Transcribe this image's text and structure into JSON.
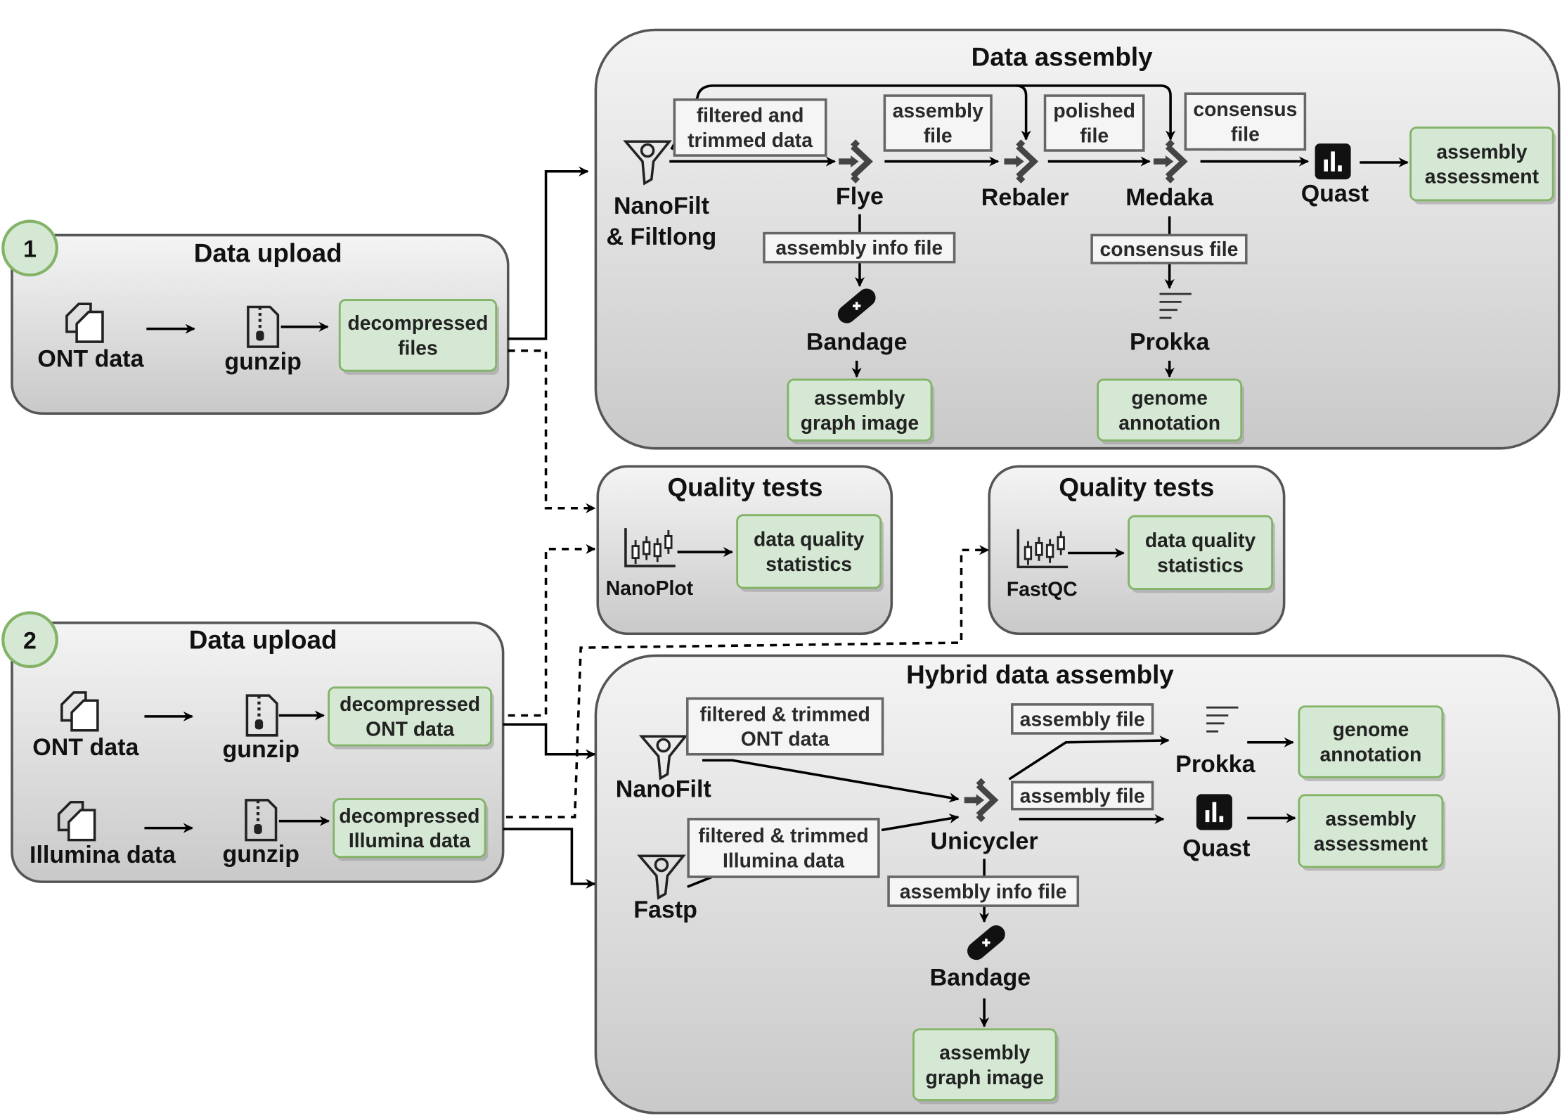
{
  "upload1": {
    "title": "Data upload",
    "badge": "1",
    "input": "ONT data",
    "tool": "gunzip",
    "output": [
      "decompressed",
      "files"
    ]
  },
  "assembly": {
    "title": "Data assembly",
    "filter_tool": [
      "NanoFilt",
      "& Filtlong"
    ],
    "filtered_label": [
      "filtered and",
      "trimmed data"
    ],
    "flye": "Flye",
    "assembly_file_label": [
      "assembly",
      "file"
    ],
    "rebaler": "Rebaler",
    "polished_label": [
      "polished",
      "file"
    ],
    "medaka": "Medaka",
    "consensus_label": [
      "consensus",
      "file"
    ],
    "quast": "Quast",
    "assessment": [
      "assembly",
      "assessment"
    ],
    "assembly_info_label": "assembly info file",
    "bandage": "Bandage",
    "graph_image": [
      "assembly",
      "graph image"
    ],
    "consensus_file_label": "consensus file",
    "prokka": "Prokka",
    "genome_annotation": [
      "genome",
      "annotation"
    ]
  },
  "quality1": {
    "title": "Quality tests",
    "tool": "NanoPlot",
    "output": [
      "data quality",
      "statistics"
    ]
  },
  "quality2": {
    "title": "Quality tests",
    "tool": "FastQC",
    "output": [
      "data quality",
      "statistics"
    ]
  },
  "upload2": {
    "title": "Data upload",
    "badge": "2",
    "ont_input": "ONT data",
    "ont_tool": "gunzip",
    "ont_output": [
      "decompressed",
      "ONT data"
    ],
    "illumina_input": "Illumina data",
    "illumina_tool": "gunzip",
    "illumina_output": [
      "decompressed",
      "Illumina data"
    ]
  },
  "hybrid": {
    "title": "Hybrid data assembly",
    "nanofilt": "NanoFilt",
    "ont_label": [
      "filtered & trimmed",
      "ONT data"
    ],
    "fastp": "Fastp",
    "illumina_label": [
      "filtered & trimmed",
      "Illumina data"
    ],
    "unicycler": "Unicycler",
    "assembly_file_label_1": "assembly file",
    "assembly_file_label_2": "assembly file",
    "prokka": "Prokka",
    "quast": "Quast",
    "genome_annotation": [
      "genome",
      "annotation"
    ],
    "assessment": [
      "assembly",
      "assessment"
    ],
    "assembly_info_label": "assembly info file",
    "bandage": "Bandage",
    "graph_image": [
      "assembly",
      "graph image"
    ]
  },
  "colors": {
    "output_fill": "#d5e8d4",
    "output_stroke": "#82b366",
    "group_stroke": "#555555",
    "label_fill": "#f5f5f5"
  }
}
